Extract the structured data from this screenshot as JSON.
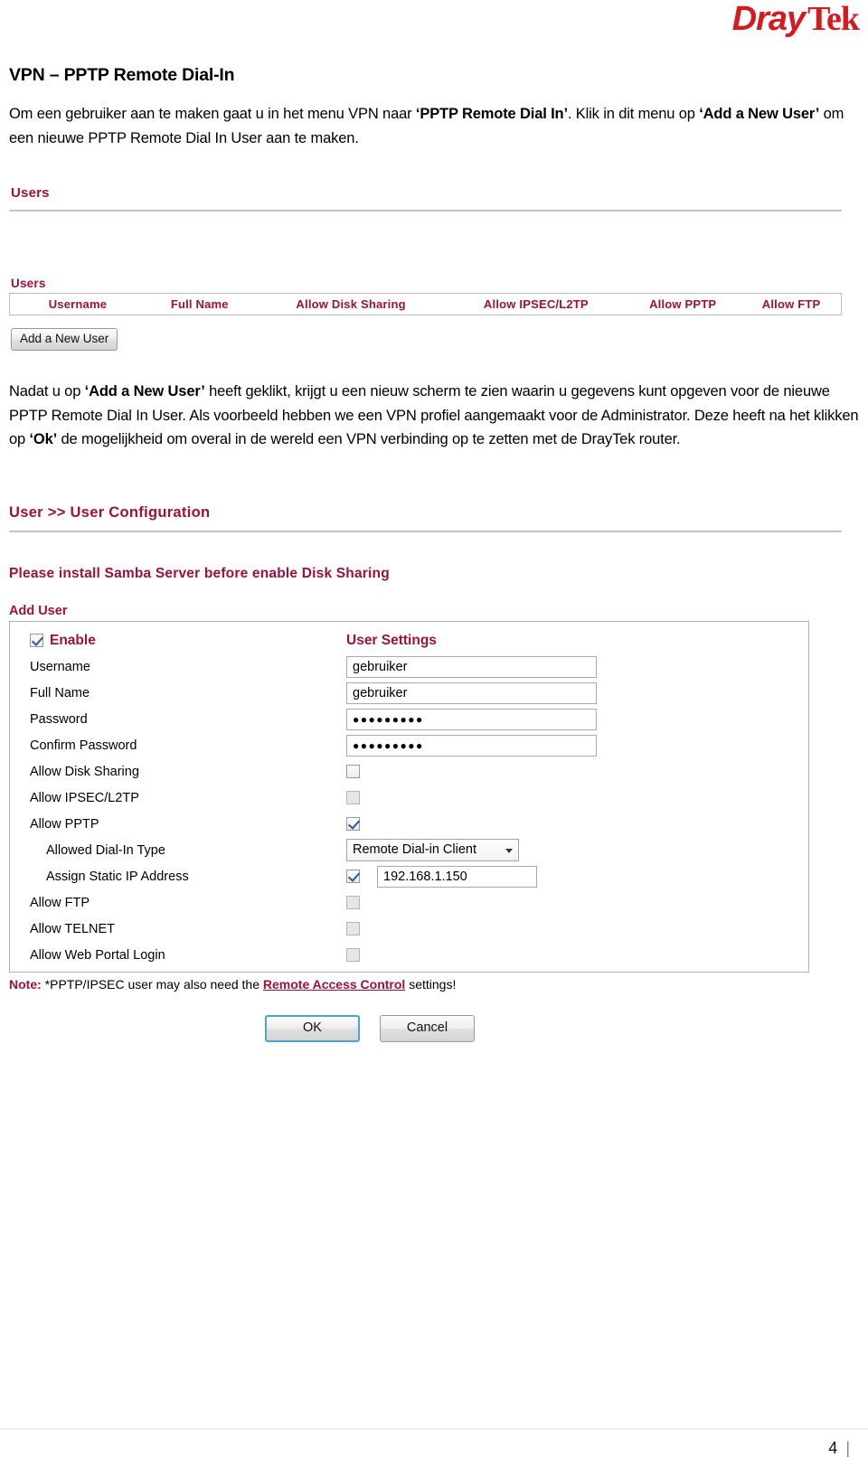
{
  "brand": {
    "name_part1": "Dray",
    "name_part2": "Tek",
    "color": "#d71920"
  },
  "document": {
    "title": "VPN – PPTP Remote Dial-In",
    "paragraph1": {
      "seg1": "Om een gebruiker aan te maken gaat u in het menu VPN naar ",
      "bold1": "‘PPTP Remote Dial In’",
      "seg2": ". Klik in dit menu op ",
      "bold2": "‘Add a New User’",
      "seg3": " om een nieuwe PPTP Remote Dial In User aan te maken."
    },
    "paragraph2": {
      "seg1": "Nadat u op ",
      "bold1": "‘Add a New User’",
      "seg2": " heeft geklikt, krijgt u een nieuw scherm te zien waarin u gegevens kunt opgeven voor de nieuwe PPTP Remote Dial In User. Als voorbeeld hebben we een VPN profiel aangemaakt voor de Administrator. Deze heeft na het klikken op ",
      "bold2": "‘Ok’",
      "seg3": " de mogelijkheid om overal in de wereld een VPN verbinding op te zetten met de DrayTek router."
    },
    "page_number": "4"
  },
  "users_screen": {
    "heading": "Users",
    "section_label": "Users",
    "columns": [
      "Username",
      "Full Name",
      "Allow Disk Sharing",
      "Allow IPSEC/L2TP",
      "Allow PPTP",
      "Allow FTP"
    ],
    "rows": [],
    "add_button": "Add a New User"
  },
  "user_config_screen": {
    "breadcrumb": "User >> User Configuration",
    "warning": "Please install Samba Server before enable Disk Sharing",
    "panel_label": "Add User",
    "enable_label": "Enable",
    "enable_checked": true,
    "settings_header": "User Settings",
    "fields": [
      {
        "label": "Username",
        "value": "gebruiker",
        "type": "text"
      },
      {
        "label": "Full Name",
        "value": "gebruiker",
        "type": "text"
      },
      {
        "label": "Password",
        "value": "●●●●●●●●●",
        "type": "password"
      },
      {
        "label": "Confirm Password",
        "value": "●●●●●●●●●",
        "type": "password"
      },
      {
        "label": "Allow Disk Sharing",
        "type": "checkbox",
        "checked": false,
        "disabled": false
      },
      {
        "label": "Allow IPSEC/L2TP",
        "type": "checkbox",
        "checked": false,
        "disabled": true
      },
      {
        "label": "Allow PPTP",
        "type": "checkbox",
        "checked": true,
        "disabled": false
      },
      {
        "label": "Allowed Dial-In Type",
        "type": "select",
        "value": "Remote Dial-in Client"
      },
      {
        "label": "Assign Static IP Address",
        "type": "checkbox_text",
        "checked": true,
        "value": "192.168.1.150"
      },
      {
        "label": "Allow FTP",
        "type": "checkbox",
        "checked": false,
        "disabled": true
      },
      {
        "label": "Allow TELNET",
        "type": "checkbox",
        "checked": false,
        "disabled": true
      },
      {
        "label": "Allow Web Portal Login",
        "type": "checkbox",
        "checked": false,
        "disabled": true
      }
    ],
    "note": {
      "prefix": "Note:",
      "text1": " *PPTP/IPSEC user may also need the ",
      "link": "Remote Access Control",
      "text2": " settings!"
    },
    "ok_button": "OK",
    "cancel_button": "Cancel"
  }
}
